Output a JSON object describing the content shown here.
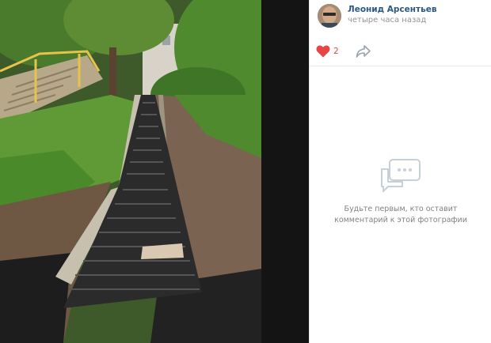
{
  "author": {
    "name": "Леонид Арсентьев",
    "time": "четыре часа назад"
  },
  "actions": {
    "likes_count": "2",
    "like_icon": "heart-icon",
    "share_icon": "share-icon"
  },
  "comments": {
    "empty_icon": "comments-icon",
    "empty_line1": "Будьте первым, кто оставит",
    "empty_line2": "комментарий к этой фотографии"
  },
  "colors": {
    "link": "#2a5885",
    "like": "#e64646",
    "muted": "#939393"
  }
}
